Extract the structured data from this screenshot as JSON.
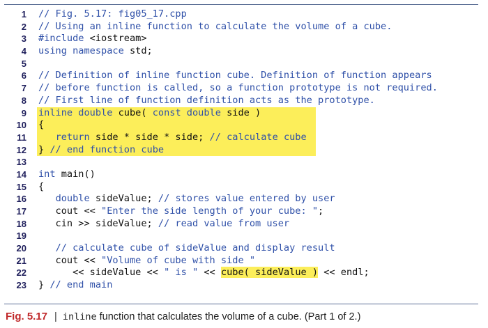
{
  "code": {
    "lines": [
      {
        "num": "1",
        "segments": [
          {
            "t": "// Fig. 5.17: fig05_17.cpp",
            "c": "comment"
          }
        ]
      },
      {
        "num": "2",
        "segments": [
          {
            "t": "// Using an inline function to calculate the volume of a cube.",
            "c": "comment"
          }
        ]
      },
      {
        "num": "3",
        "segments": [
          {
            "t": "#include",
            "c": "keyword"
          },
          {
            "t": " <iostream>",
            "c": "plain"
          }
        ]
      },
      {
        "num": "4",
        "segments": [
          {
            "t": "using namespace",
            "c": "keyword"
          },
          {
            "t": " std;",
            "c": "plain"
          }
        ]
      },
      {
        "num": "5",
        "segments": []
      },
      {
        "num": "6",
        "segments": [
          {
            "t": "// Definition of inline function cube. Definition of function appears",
            "c": "comment"
          }
        ]
      },
      {
        "num": "7",
        "segments": [
          {
            "t": "// before function is called, so a function prototype is not required.",
            "c": "comment"
          }
        ]
      },
      {
        "num": "8",
        "segments": [
          {
            "t": "// First line of function definition acts as the prototype.",
            "c": "comment"
          }
        ]
      },
      {
        "num": "9",
        "highlight": 400,
        "segments": [
          {
            "t": "inline double",
            "c": "keyword"
          },
          {
            "t": " cube( ",
            "c": "plain"
          },
          {
            "t": "const double",
            "c": "keyword"
          },
          {
            "t": " side )",
            "c": "plain"
          }
        ]
      },
      {
        "num": "10",
        "highlight": 400,
        "segments": [
          {
            "t": "{",
            "c": "plain"
          }
        ]
      },
      {
        "num": "11",
        "highlight": 400,
        "segments": [
          {
            "t": "   ",
            "c": "plain"
          },
          {
            "t": "return",
            "c": "keyword"
          },
          {
            "t": " side * side * side; ",
            "c": "plain"
          },
          {
            "t": "// calculate cube",
            "c": "comment"
          }
        ]
      },
      {
        "num": "12",
        "highlight": 400,
        "segments": [
          {
            "t": "} ",
            "c": "plain"
          },
          {
            "t": "// end function cube",
            "c": "comment"
          }
        ]
      },
      {
        "num": "13",
        "segments": []
      },
      {
        "num": "14",
        "segments": [
          {
            "t": "int",
            "c": "keyword"
          },
          {
            "t": " main()",
            "c": "plain"
          }
        ]
      },
      {
        "num": "15",
        "segments": [
          {
            "t": "{",
            "c": "plain"
          }
        ]
      },
      {
        "num": "16",
        "segments": [
          {
            "t": "   ",
            "c": "plain"
          },
          {
            "t": "double",
            "c": "keyword"
          },
          {
            "t": " sideValue; ",
            "c": "plain"
          },
          {
            "t": "// stores value entered by user",
            "c": "comment"
          }
        ]
      },
      {
        "num": "17",
        "segments": [
          {
            "t": "   cout << ",
            "c": "plain"
          },
          {
            "t": "\"Enter the side length of your cube: \"",
            "c": "string"
          },
          {
            "t": ";",
            "c": "plain"
          }
        ]
      },
      {
        "num": "18",
        "segments": [
          {
            "t": "   cin >> sideValue; ",
            "c": "plain"
          },
          {
            "t": "// read value from user",
            "c": "comment"
          }
        ]
      },
      {
        "num": "19",
        "segments": []
      },
      {
        "num": "20",
        "segments": [
          {
            "t": "   ",
            "c": "plain"
          },
          {
            "t": "// calculate cube of sideValue and display result",
            "c": "comment"
          }
        ]
      },
      {
        "num": "21",
        "segments": [
          {
            "t": "   cout << ",
            "c": "plain"
          },
          {
            "t": "\"Volume of cube with side \"",
            "c": "string"
          }
        ]
      },
      {
        "num": "22",
        "segments": [
          {
            "t": "      << sideValue << ",
            "c": "plain"
          },
          {
            "t": "\" is \"",
            "c": "string"
          },
          {
            "t": " << ",
            "c": "plain"
          },
          {
            "t": "cube( sideValue )",
            "c": "plain",
            "hl": true
          },
          {
            "t": " << endl;",
            "c": "plain"
          }
        ]
      },
      {
        "num": "23",
        "segments": [
          {
            "t": "} ",
            "c": "plain"
          },
          {
            "t": "// end main",
            "c": "comment"
          }
        ]
      }
    ]
  },
  "caption": {
    "figure_label": "Fig. 5.17",
    "separator": "|",
    "keyword": "inline",
    "text": " function that calculates the volume of a cube. (Part 1 of 2.)"
  },
  "colors": {
    "highlight": "#fcee5a",
    "comment_blue": "#2f50a8",
    "figure_red": "#c0282a",
    "rule": "#5a6d94"
  }
}
